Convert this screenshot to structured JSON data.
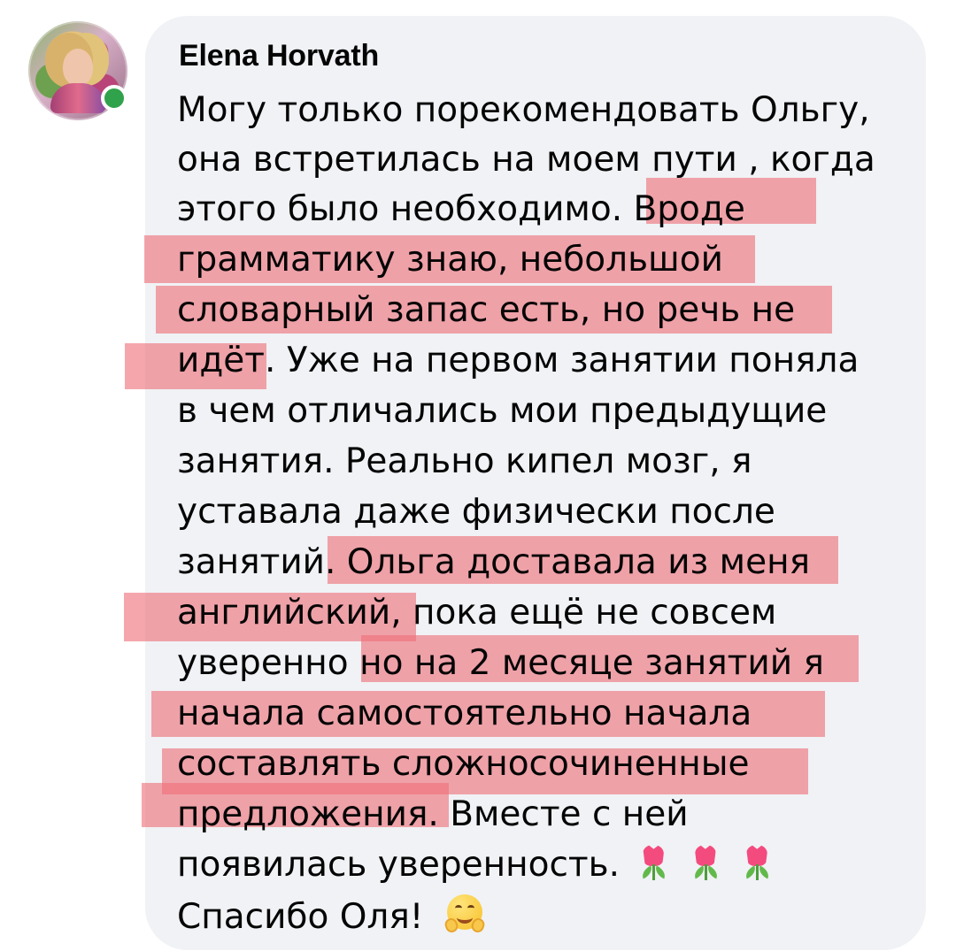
{
  "comment": {
    "author": "Elena Horvath",
    "lines": [
      "Могу только порекомендовать Ольгу,",
      "она встретилась на моем пути , когда",
      "этого было необходимо. Вроде",
      "грамматику знаю, небольшой",
      "словарный запас есть, но речь не",
      "идёт. Уже на первом занятии поняла",
      "в чем отличались мои предыдущие",
      "занятия. Реально кипел мозг, я",
      "уставала даже физически после",
      "занятий. Ольга доставала из меня",
      "английский, пока ещё не совсем",
      "уверенно но на 2 месяце занятий я",
      "начала самостоятельно начала",
      "составлять сложносочиненные",
      "предложения. Вместе с ней",
      "появилась уверенность. ",
      "Спасибо Оля! "
    ]
  },
  "icons": {
    "avatar": "profile-photo",
    "online": "online-status-icon",
    "tulip": "tulip-emoji-icon",
    "hug": "hugging-face-emoji-icon"
  },
  "colors": {
    "bubble": "#f0f2f5",
    "text": "#050505",
    "highlight": "#ef6f79",
    "online": "#31a24c"
  }
}
